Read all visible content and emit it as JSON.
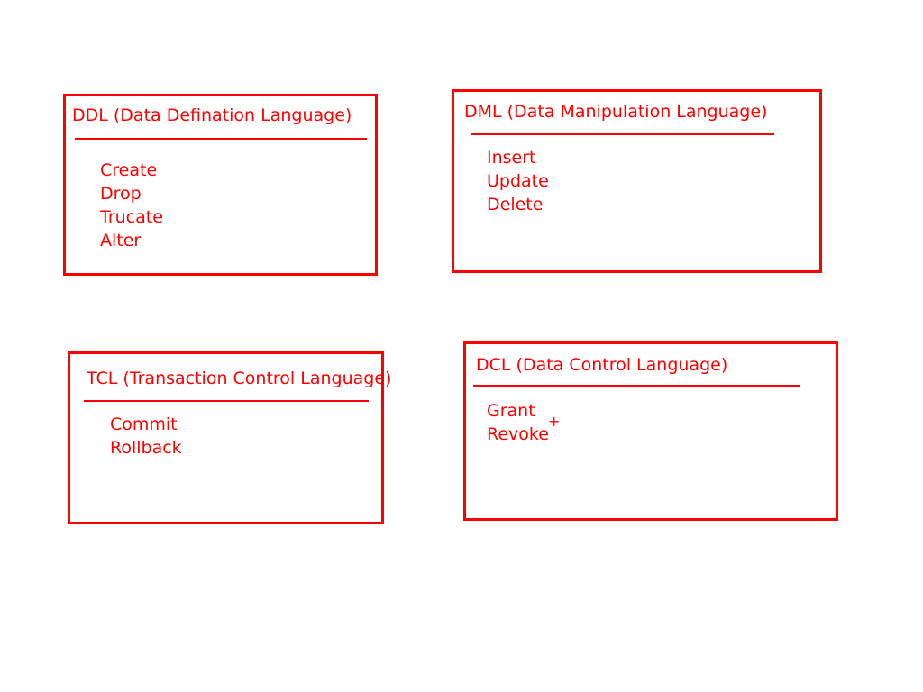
{
  "colors": {
    "ink": "#ff0000",
    "background": "#ffffff"
  },
  "boxes": {
    "ddl": {
      "title": "DDL (Data Defination Language)",
      "items": [
        "Create",
        "Drop",
        "Trucate",
        "Alter"
      ]
    },
    "dml": {
      "title": "DML (Data Manipulation Language)",
      "items": [
        "Insert",
        "Update",
        "Delete"
      ]
    },
    "tcl": {
      "title": "TCL (Transaction Control Language)",
      "items": [
        "Commit",
        "Rollback"
      ]
    },
    "dcl": {
      "title": "DCL (Data Control Language)",
      "items": [
        "Grant",
        "Revoke"
      ]
    }
  },
  "cursor": {
    "icon": "crosshair-cursor-icon",
    "glyph": "+"
  }
}
